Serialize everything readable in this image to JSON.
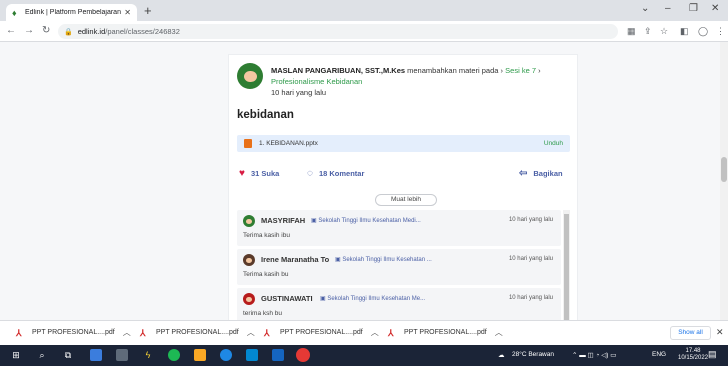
{
  "browser": {
    "tab_title": "Edlink | Platform Pembelajaran In",
    "url_host": "edlink.id",
    "url_path": "/panel/classes/246832"
  },
  "post": {
    "author": "MASLAN PANGARIBUAN, SST.,M.Kes",
    "action_text": "menambahkan materi pada",
    "section": "Sesi ke 7",
    "subject": "Profesionalisme Kebidanan",
    "time": "10 hari yang lalu",
    "title": "kebidanan",
    "attachment": {
      "name": "1. KEBIDANAN.pptx",
      "download_label": "Unduh"
    },
    "likes_label": "31 Suka",
    "comments_label": "18 Komentar",
    "share_label": "Bagikan",
    "see_more_label": "Muat lebih"
  },
  "comments": [
    {
      "name": "MASYRIFAH",
      "institution": "Sekolah Tinggi Ilmu Kesehatan Medi...",
      "time": "10 hari yang lalu",
      "text": "Terima kasih ibu",
      "avatar_color": "#2e7d32"
    },
    {
      "name": "Irene Maranatha To",
      "institution": "Sekolah Tinggi Ilmu Kesehatan ...",
      "time": "10 hari yang lalu",
      "text": "Terima kasih bu",
      "avatar_color": "#5a3a2a"
    },
    {
      "name": "GUSTINAWATI",
      "institution": "Sekolah Tinggi Ilmu Kesehatan Me...",
      "time": "10 hari yang lalu",
      "text": "terima ksh bu",
      "avatar_color": "#b71c1c"
    }
  ],
  "downloads": [
    "PPT PROFESIONAL....pdf",
    "PPT PROFESIONAL....pdf",
    "PPT PROFESIONAL....pdf",
    "PPT PROFESIONAL....pdf"
  ],
  "show_all_label": "Show all",
  "taskbar": {
    "weather": "28°C Berawan",
    "language": "ENG",
    "time": "17.48",
    "date": "10/15/2022"
  }
}
